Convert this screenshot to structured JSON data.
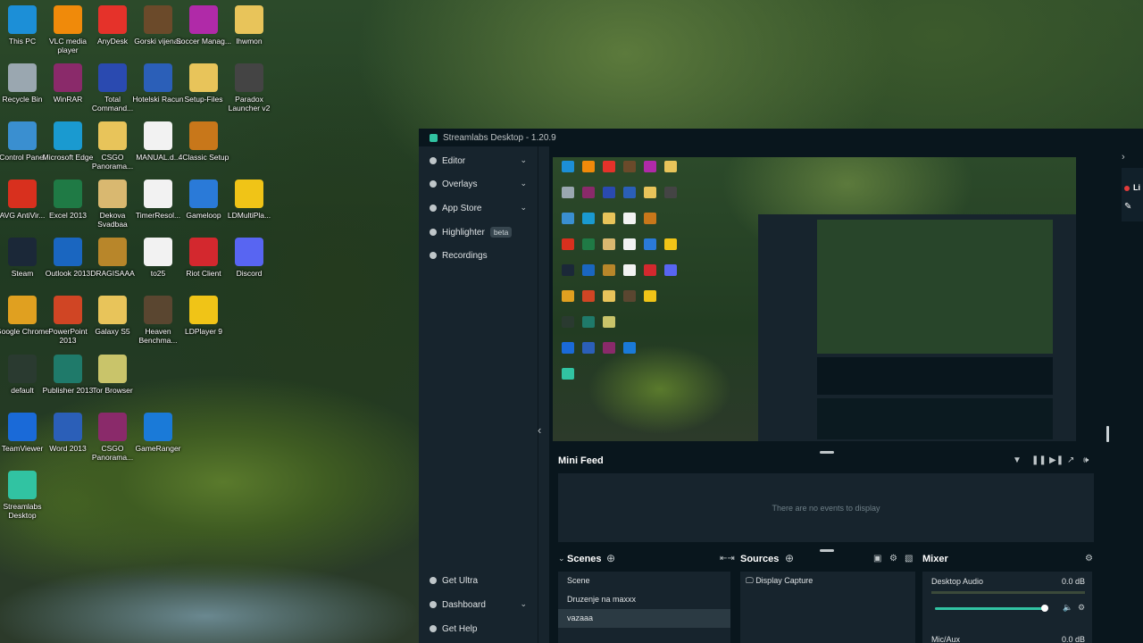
{
  "desktop": {
    "icons": [
      {
        "label": "This PC",
        "icon": "monitor-icon",
        "color": "#1c8fd7"
      },
      {
        "label": "VLC media player",
        "icon": "vlc-cone-icon",
        "color": "#f08a0a"
      },
      {
        "label": "AnyDesk",
        "icon": "anydesk-icon",
        "color": "#e5322a"
      },
      {
        "label": "Gorski vijenac",
        "icon": "portrait-icon",
        "color": "#6b4a2a"
      },
      {
        "label": "Soccer Manag...",
        "icon": "sm-icon",
        "color": "#b02aa8"
      },
      {
        "label": "lhwmon",
        "icon": "folder-icon",
        "color": "#e8c45a"
      },
      {
        "label": "Recycle Bin",
        "icon": "recycle-bin-icon",
        "color": "#9aa7b0"
      },
      {
        "label": "WinRAR",
        "icon": "winrar-icon",
        "color": "#8a2a6a"
      },
      {
        "label": "Total Command...",
        "icon": "floppy-icon",
        "color": "#2a4ab0"
      },
      {
        "label": "Hotelski Racun",
        "icon": "word-doc-icon",
        "color": "#2b5fb8"
      },
      {
        "label": "Setup-Files",
        "icon": "folder-icon",
        "color": "#e8c45a"
      },
      {
        "label": "Paradox Launcher v2",
        "icon": "paradox-icon",
        "color": "#444444"
      },
      {
        "label": "Control Panel",
        "icon": "control-panel-icon",
        "color": "#3a8fd0"
      },
      {
        "label": "Microsoft Edge",
        "icon": "edge-icon",
        "color": "#1a9ad0"
      },
      {
        "label": "CSGO Panorama...",
        "icon": "folder-icon",
        "color": "#e8c45a"
      },
      {
        "label": "MANUAL.d...",
        "icon": "document-icon",
        "color": "#f2f2f2"
      },
      {
        "label": "4Classic Setup",
        "icon": "4classic-icon",
        "color": "#c8771a"
      },
      {
        "label": "AVG AntiVir...",
        "icon": "avg-icon",
        "color": "#d8301e"
      },
      {
        "label": "Excel 2013",
        "icon": "excel-icon",
        "color": "#1f7a45"
      },
      {
        "label": "Dekova Svadbaa",
        "icon": "folder-image-icon",
        "color": "#d9b870"
      },
      {
        "label": "TimerResol...",
        "icon": "clock-icon",
        "color": "#f2f2f2"
      },
      {
        "label": "Gameloop",
        "icon": "gameloop-icon",
        "color": "#2a7ad8"
      },
      {
        "label": "LDMultiPla...",
        "icon": "ldmulti-icon",
        "color": "#f0c417"
      },
      {
        "label": "Steam",
        "icon": "steam-icon",
        "color": "#1b2838"
      },
      {
        "label": "Outlook 2013",
        "icon": "outlook-icon",
        "color": "#1a66c0"
      },
      {
        "label": "DRAGISAAA",
        "icon": "folder-image-icon",
        "color": "#b8862a"
      },
      {
        "label": "to25",
        "icon": "document-icon",
        "color": "#f2f2f2"
      },
      {
        "label": "Riot Client",
        "icon": "riot-icon",
        "color": "#d3282e"
      },
      {
        "label": "Discord",
        "icon": "discord-icon",
        "color": "#5865f2"
      },
      {
        "label": "Google Chrome",
        "icon": "chrome-icon",
        "color": "#e0a020"
      },
      {
        "label": "PowerPoint 2013",
        "icon": "powerpoint-icon",
        "color": "#d04524"
      },
      {
        "label": "Galaxy S5",
        "icon": "folder-icon",
        "color": "#e8c45a"
      },
      {
        "label": "Heaven Benchma...",
        "icon": "heaven-icon",
        "color": "#5a4630"
      },
      {
        "label": "LDPlayer 9",
        "icon": "ldplayer-icon",
        "color": "#f0c417"
      },
      {
        "label": "default",
        "icon": "blank-file-icon",
        "color": "#2a3a30"
      },
      {
        "label": "Publisher 2013",
        "icon": "publisher-icon",
        "color": "#1f7a6a"
      },
      {
        "label": "Tor Browser",
        "icon": "folder-image-icon",
        "color": "#c9c46a"
      },
      {
        "label": "TeamViewer",
        "icon": "teamviewer-icon",
        "color": "#1a6ad8"
      },
      {
        "label": "Word 2013",
        "icon": "word-icon",
        "color": "#2b5fb8"
      },
      {
        "label": "CSGO Panorama...",
        "icon": "winrar-icon",
        "color": "#8a2a6a"
      },
      {
        "label": "GameRanger",
        "icon": "gameranger-icon",
        "color": "#1a7ad8"
      },
      {
        "label": "Streamlabs Desktop",
        "icon": "streamlabs-icon",
        "color": "#31c3a2"
      }
    ]
  },
  "window": {
    "title": "Streamlabs Desktop - 1.20.9",
    "nav_top": [
      {
        "label": "Editor",
        "icon": "editor-icon",
        "expandable": true
      },
      {
        "label": "Overlays",
        "icon": "overlays-icon",
        "expandable": true
      },
      {
        "label": "App Store",
        "icon": "app-store-icon",
        "expandable": true
      },
      {
        "label": "Highlighter",
        "icon": "highlighter-icon",
        "badge": "beta"
      },
      {
        "label": "Recordings",
        "icon": "recordings-icon"
      }
    ],
    "nav_bottom": [
      {
        "label": "Get Ultra",
        "icon": "ultra-icon"
      },
      {
        "label": "Dashboard",
        "icon": "dashboard-icon",
        "expandable": true
      },
      {
        "label": "Get Help",
        "icon": "help-icon"
      }
    ],
    "mini_feed": {
      "title": "Mini Feed",
      "empty_text": "There are no events to display"
    },
    "scenes": {
      "title": "Scenes",
      "items": [
        "Scene",
        "Druzenje na maxxx",
        "vazaaa"
      ],
      "active_index": 2
    },
    "sources": {
      "title": "Sources",
      "items": [
        "Display Capture"
      ]
    },
    "mixer": {
      "title": "Mixer",
      "channels": [
        {
          "name": "Desktop Audio",
          "level": "0.0 dB",
          "volume": 0.98
        },
        {
          "name": "Mic/Aux",
          "level": "0.0 dB"
        }
      ]
    },
    "right_panel": {
      "label": "Li"
    },
    "accent": "#31c3a2",
    "live_dot": "#e23b3b"
  }
}
